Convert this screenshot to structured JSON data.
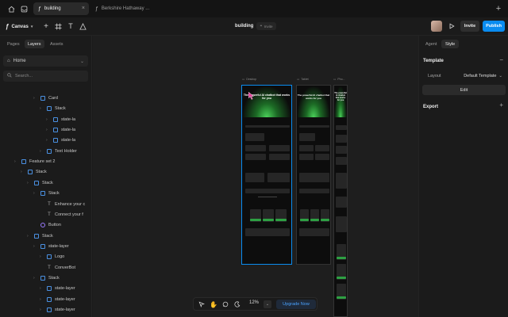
{
  "tabs": [
    {
      "label": "building",
      "active": true
    },
    {
      "label": "Berkshire Hathaway ...",
      "active": false
    }
  ],
  "toolbar": {
    "canvas_label": "Canvas",
    "doc_title": "building",
    "badge": "Invite",
    "invite_label": "Invite",
    "publish_label": "Publish"
  },
  "left_panel": {
    "tabs": [
      "Pages",
      "Layers",
      "Assets"
    ],
    "active_tab": "Layers",
    "page": "Home",
    "search_placeholder": "Search..."
  },
  "layers": [
    {
      "name": "Card",
      "type": "stack",
      "depth": 4
    },
    {
      "name": "Stack",
      "type": "stack",
      "depth": 5
    },
    {
      "name": "state-la",
      "type": "stack",
      "depth": 6
    },
    {
      "name": "state-la",
      "type": "stack",
      "depth": 6
    },
    {
      "name": "state-la",
      "type": "stack",
      "depth": 6
    },
    {
      "name": "Text Holder",
      "type": "stack",
      "depth": 5
    },
    {
      "name": "Feature set 2",
      "type": "stack",
      "depth": 1
    },
    {
      "name": "Stack",
      "type": "stack",
      "depth": 2
    },
    {
      "name": "Stack",
      "type": "stack",
      "depth": 3
    },
    {
      "name": "Stack",
      "type": "stack",
      "depth": 4
    },
    {
      "name": "Enhance your c",
      "type": "text",
      "depth": 5
    },
    {
      "name": "Connect your f",
      "type": "text",
      "depth": 5
    },
    {
      "name": "Button",
      "type": "component",
      "depth": 4
    },
    {
      "name": "Stack",
      "type": "stack",
      "depth": 3
    },
    {
      "name": "state-layer",
      "type": "stack",
      "depth": 4
    },
    {
      "name": "Logo",
      "type": "stack",
      "depth": 5
    },
    {
      "name": "ConverBot",
      "type": "text",
      "depth": 5
    },
    {
      "name": "Stack",
      "type": "stack",
      "depth": 4
    },
    {
      "name": "state-layer",
      "type": "stack",
      "depth": 5
    },
    {
      "name": "state-layer",
      "type": "stack",
      "depth": 5
    },
    {
      "name": "state-layer",
      "type": "stack",
      "depth": 5
    }
  ],
  "canvas": {
    "frames": [
      {
        "label": "Desktop"
      },
      {
        "label": "Tablet"
      },
      {
        "label": "Pho..."
      }
    ],
    "hero_text": "The powerful AI chatbot that works for you"
  },
  "bottom_bar": {
    "zoom": "12%",
    "upgrade_label": "Upgrade Now"
  },
  "right_panel": {
    "tabs": [
      "Agent",
      "Style"
    ],
    "active_tab": "Style",
    "template_title": "Template",
    "layout_label": "Layout",
    "layout_value": "Default Template",
    "edit_label": "Edit",
    "export_title": "Export"
  },
  "colors": {
    "accent": "#0a8cf0",
    "brand_green": "#2ea043",
    "bg": "#1b1b1b"
  }
}
